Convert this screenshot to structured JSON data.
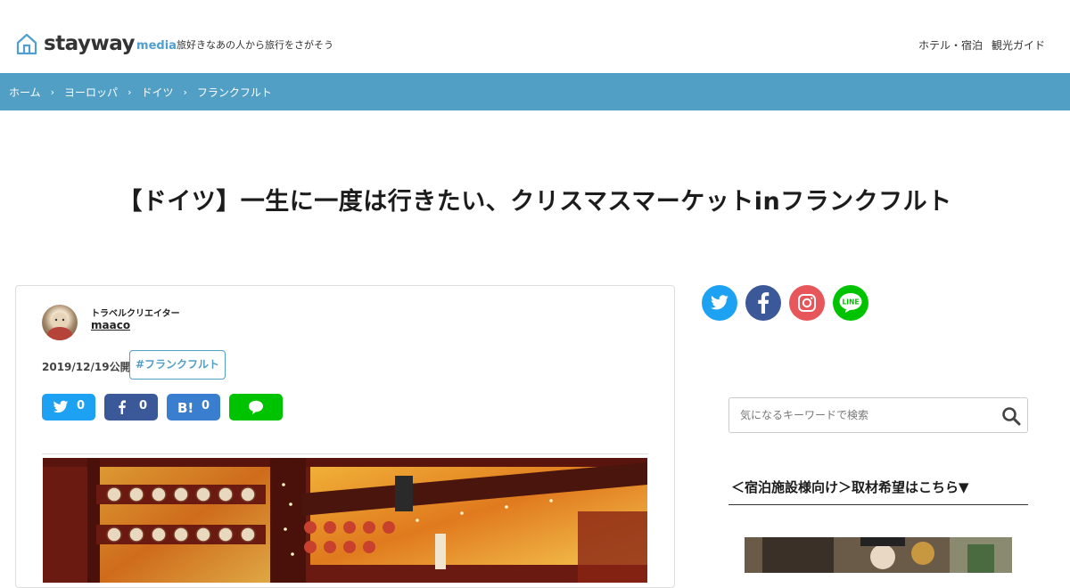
{
  "header": {
    "logo_text": "stayway",
    "logo_sub": "media",
    "tagline": "旅好きなあの人から旅行をさがそう",
    "nav": [
      "ホテル・宿泊",
      "観光ガイド"
    ]
  },
  "breadcrumb": [
    "ホーム",
    "ヨーロッパ",
    "ドイツ",
    "フランクフルト"
  ],
  "article": {
    "title": "【ドイツ】一生に一度は行きたい、クリスマスマーケットinフランクフルト",
    "author_role": "トラベルクリエイター",
    "author_name": "maaco",
    "published": "2019/12/19公開",
    "tag": "#フランクフルト",
    "share": {
      "twitter_count": "0",
      "facebook_count": "0",
      "hatena_count": "0"
    }
  },
  "sidebar": {
    "search_placeholder": "気になるキーワードで検索",
    "heading": "＜宿泊施設様向け＞取材希望はこちら▼",
    "social_icons": [
      "twitter-icon",
      "facebook-icon",
      "instagram-icon",
      "line-icon"
    ]
  },
  "colors": {
    "accent": "#529fc6",
    "twitter": "#1da1f2",
    "facebook": "#3b5998",
    "hatena": "#3a7ecf",
    "line": "#00c300",
    "instagram": "#e6565a"
  }
}
